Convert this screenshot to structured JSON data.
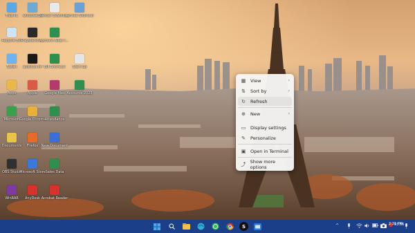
{
  "desktop": {
    "icons": [
      {
        "label": "This PC",
        "icon": "computer-icon",
        "color": "#5aa8e8"
      },
      {
        "label": "windows10",
        "icon": "globe-icon",
        "color": "#6fa9d6"
      },
      {
        "label": "Xender Download",
        "icon": "xender-icon",
        "color": "#e9e9e9"
      },
      {
        "label": "service Shortcut",
        "icon": "document-icon",
        "color": "#6aa1d6"
      },
      {
        "label": "Recycle Bin",
        "icon": "recycle-bin-icon",
        "color": "#cfe3f2"
      },
      {
        "label": "Playstation...",
        "icon": "game-icon",
        "color": "#2a2a2a"
      },
      {
        "label": "Account Alias for t...",
        "icon": "spreadsheet-icon",
        "color": "#2f8f4e"
      },
      {
        "label": "Safari",
        "icon": "safari-icon",
        "color": "#6fb3f0"
      },
      {
        "label": "autorun.inf",
        "icon": "file-icon",
        "color": "#1a1a1a"
      },
      {
        "label": "Bill Shortcut",
        "icon": "bill-icon",
        "color": "#2f8f4e"
      },
      {
        "label": "Start Up",
        "icon": "startup-icon",
        "color": "#e5e5e5"
      },
      {
        "label": "Apps",
        "icon": "folder-icon",
        "color": "#e8b84a"
      },
      {
        "label": "Apple",
        "icon": "folder-icon",
        "color": "#d95b46"
      },
      {
        "label": "Google files",
        "icon": "winrar-icon",
        "color": "#b23a6d"
      },
      {
        "label": "Accounts 2023",
        "icon": "spreadsheet-icon",
        "color": "#2f8f4e"
      },
      {
        "label": "Microsoft",
        "icon": "app-icon",
        "color": "#3a9f4f"
      },
      {
        "label": "Google Chrome",
        "icon": "chrome-icon",
        "color": "#e8b03a"
      },
      {
        "label": "Attendance",
        "icon": "spreadsheet-icon",
        "color": "#2f8f4e"
      },
      {
        "label": "Documents",
        "icon": "folder-icon",
        "color": "#e8c54a"
      },
      {
        "label": "Firefox",
        "icon": "firefox-icon",
        "color": "#e66b2a"
      },
      {
        "label": "New Document",
        "icon": "document-icon",
        "color": "#3b6fd6"
      },
      {
        "label": "OBS Studio",
        "icon": "obs-icon",
        "color": "#303030"
      },
      {
        "label": "Microsoft Store",
        "icon": "store-icon",
        "color": "#3a79d8"
      },
      {
        "label": "Sales Data",
        "icon": "spreadsheet-icon",
        "color": "#2f8f4e"
      },
      {
        "label": "WinRAR",
        "icon": "winrar-icon",
        "color": "#7d3aa0"
      },
      {
        "label": "AnyDesk",
        "icon": "anydesk-icon",
        "color": "#d8322e"
      },
      {
        "label": "Acrobat Reader",
        "icon": "pdf-icon",
        "color": "#d8322e"
      }
    ]
  },
  "context_menu": {
    "items": [
      {
        "label": "View",
        "icon": "grid-view-icon",
        "glyph": "▦",
        "chevron": true
      },
      {
        "label": "Sort by",
        "icon": "sort-icon",
        "glyph": "⇅",
        "chevron": true
      },
      {
        "label": "Refresh",
        "icon": "refresh-icon",
        "glyph": "↻",
        "chevron": false
      },
      {
        "label": "New",
        "icon": "new-icon",
        "glyph": "⊕",
        "chevron": true
      },
      {
        "label": "Display settings",
        "icon": "display-icon",
        "glyph": "▭",
        "chevron": false
      },
      {
        "label": "Personalize",
        "icon": "brush-icon",
        "glyph": "✎",
        "chevron": false
      },
      {
        "label": "Open in Terminal",
        "icon": "terminal-icon",
        "glyph": "▣",
        "chevron": false
      },
      {
        "label": "Show more options",
        "icon": "more-options-icon",
        "glyph": "⤴",
        "chevron": false
      }
    ],
    "chevron_glyph": "›"
  },
  "taskbar": {
    "start_icon": "windows-start-icon",
    "apps": [
      {
        "icon": "search-icon",
        "glyph": "⌕",
        "color": "#ffffff"
      },
      {
        "icon": "file-explorer-icon",
        "glyph": "",
        "color": "#f2c14b"
      },
      {
        "icon": "edge-icon",
        "glyph": "",
        "color": "#2fb3c9"
      },
      {
        "icon": "whatsapp-icon",
        "glyph": "",
        "color": "#2fbf59"
      },
      {
        "icon": "chrome-icon",
        "glyph": "",
        "color": "#e8b03a"
      },
      {
        "icon": "app-s-icon",
        "glyph": "S",
        "color": "#111111"
      },
      {
        "icon": "outlook-icon",
        "glyph": "",
        "color": "#2f7ad6"
      }
    ],
    "tray": {
      "chevron_glyph": "^",
      "clock_time": "2:31 PM",
      "recording_label": "03:56"
    }
  }
}
